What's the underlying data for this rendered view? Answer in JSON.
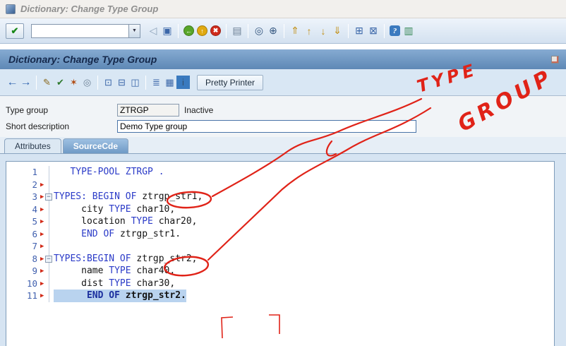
{
  "window": {
    "title": "Dictionary: Change Type Group"
  },
  "header": {
    "title": "Dictionary: Change Type Group"
  },
  "toolbar": {
    "enter_glyph": "✔",
    "command_value": "",
    "dropdown_glyph": "▼",
    "groups": [
      [
        {
          "n": "back-triangle-icon",
          "g": "◁",
          "c": "#8aa0b8"
        },
        {
          "n": "save-icon",
          "g": "▣",
          "c": "#3a66a8"
        }
      ],
      [
        {
          "n": "back-icon",
          "g": "←",
          "bg": "#57a529"
        },
        {
          "n": "exit-icon",
          "g": "↑",
          "bg": "#e0a910"
        },
        {
          "n": "cancel-icon",
          "g": "✖",
          "bg": "#cf2a1b"
        }
      ],
      [
        {
          "n": "print-icon",
          "g": "▤",
          "c": "#6b7f94"
        }
      ],
      [
        {
          "n": "find-icon",
          "g": "◎",
          "c": "#33557e"
        },
        {
          "n": "find-next-icon",
          "g": "⊕",
          "c": "#33557e"
        }
      ],
      [
        {
          "n": "first-page-icon",
          "g": "⇑",
          "c": "#c29018"
        },
        {
          "n": "page-up-icon",
          "g": "↑",
          "c": "#c29018"
        },
        {
          "n": "page-down-icon",
          "g": "↓",
          "c": "#c29018"
        },
        {
          "n": "last-page-icon",
          "g": "⇓",
          "c": "#c29018"
        }
      ],
      [
        {
          "n": "new-session-icon",
          "g": "⊞",
          "c": "#3a66a8"
        },
        {
          "n": "create-shortcut-icon",
          "g": "⊠",
          "c": "#3a66a8"
        }
      ],
      [
        {
          "n": "help-icon",
          "g": "?",
          "bg": "#3a7abf",
          "sq": true
        },
        {
          "n": "layout-menu-icon",
          "g": "▥",
          "c": "#3a8a5a"
        }
      ]
    ]
  },
  "app_toolbar": {
    "pretty_printer": "Pretty Printer",
    "groups": [
      [
        {
          "n": "previous-object-icon",
          "g": "←",
          "arrow": true
        },
        {
          "n": "next-object-icon",
          "g": "→",
          "arrow": true
        }
      ],
      [
        {
          "n": "display-change-icon",
          "g": "✎",
          "c": "#8a6a20"
        },
        {
          "n": "check-icon",
          "g": "✔",
          "c": "#2f7a2f"
        },
        {
          "n": "activate-icon",
          "g": "✶",
          "c": "#b04a10"
        },
        {
          "n": "refresh-icon",
          "g": "◎",
          "c": "#6b7f94"
        }
      ],
      [
        {
          "n": "where-used-icon",
          "g": "⊡",
          "c": "#3a66a8"
        },
        {
          "n": "object-list-icon",
          "g": "⊟",
          "c": "#3a66a8"
        },
        {
          "n": "navigation-icon",
          "g": "◫",
          "c": "#3a66a8"
        }
      ],
      [
        {
          "n": "hierarchy-icon",
          "g": "≣",
          "c": "#3a66a8"
        },
        {
          "n": "table-settings-icon",
          "g": "▦",
          "c": "#3a66a8"
        },
        {
          "n": "info-icon",
          "g": "i",
          "bg": "#3a7abf",
          "sq": true
        }
      ]
    ]
  },
  "form": {
    "type_group": {
      "label": "Type group",
      "value": "ZTRGP",
      "status": "Inactive"
    },
    "short_description": {
      "label": "Short description",
      "value": "Demo Type group"
    }
  },
  "tabs": {
    "items": [
      {
        "label": "Attributes",
        "active": false
      },
      {
        "label": "SourceCde",
        "active": true
      }
    ]
  },
  "editor": {
    "marker_glyph": "▶",
    "fold_glyph": "−",
    "keyword_color": "#2b3bc8",
    "highlight_color": "#b9d3ef",
    "lines": [
      {
        "num": "1",
        "marker": false,
        "fold": false,
        "highlight": false,
        "tokens": [
          {
            "t": "   TYPE-POOL ZTRGP .",
            "c": "kw"
          }
        ]
      },
      {
        "num": "2",
        "marker": true,
        "fold": false,
        "highlight": false,
        "tokens": []
      },
      {
        "num": "3",
        "marker": true,
        "fold": true,
        "highlight": false,
        "tokens": [
          {
            "t": "TYPES: BEGIN OF ",
            "c": "kw"
          },
          {
            "t": "ztrgp_str1,",
            "c": "id"
          }
        ]
      },
      {
        "num": "4",
        "marker": true,
        "fold": false,
        "highlight": false,
        "tokens": [
          {
            "t": "     city ",
            "c": "id"
          },
          {
            "t": "TYPE ",
            "c": "kw"
          },
          {
            "t": "char10,",
            "c": "id"
          }
        ]
      },
      {
        "num": "5",
        "marker": true,
        "fold": false,
        "highlight": false,
        "tokens": [
          {
            "t": "     location ",
            "c": "id"
          },
          {
            "t": "TYPE ",
            "c": "kw"
          },
          {
            "t": "char20,",
            "c": "id"
          }
        ]
      },
      {
        "num": "6",
        "marker": true,
        "fold": false,
        "highlight": false,
        "tokens": [
          {
            "t": "     ",
            "c": "id"
          },
          {
            "t": "END OF ",
            "c": "kw"
          },
          {
            "t": "ztrgp_str1.",
            "c": "id"
          }
        ]
      },
      {
        "num": "7",
        "marker": true,
        "fold": false,
        "highlight": false,
        "tokens": []
      },
      {
        "num": "8",
        "marker": true,
        "fold": true,
        "highlight": false,
        "tokens": [
          {
            "t": "TYPES:BEGIN OF ",
            "c": "kw"
          },
          {
            "t": "ztrgp_str2,",
            "c": "id"
          }
        ]
      },
      {
        "num": "9",
        "marker": true,
        "fold": false,
        "highlight": false,
        "tokens": [
          {
            "t": "     name ",
            "c": "id"
          },
          {
            "t": "TYPE ",
            "c": "kw"
          },
          {
            "t": "char40,",
            "c": "id"
          }
        ]
      },
      {
        "num": "10",
        "marker": true,
        "fold": false,
        "highlight": false,
        "tokens": [
          {
            "t": "     dist ",
            "c": "id"
          },
          {
            "t": "TYPE ",
            "c": "kw"
          },
          {
            "t": "char30,",
            "c": "id"
          }
        ]
      },
      {
        "num": "11",
        "marker": true,
        "fold": false,
        "highlight": true,
        "tokens": [
          {
            "t": "      ",
            "c": "id"
          },
          {
            "t": "END OF ",
            "c": "kwb"
          },
          {
            "t": "ztrgp_str2.",
            "c": "idb"
          }
        ]
      }
    ]
  },
  "annotations": {
    "word1": "TYPE",
    "word2": "GROUP",
    "color": "#e02318"
  }
}
